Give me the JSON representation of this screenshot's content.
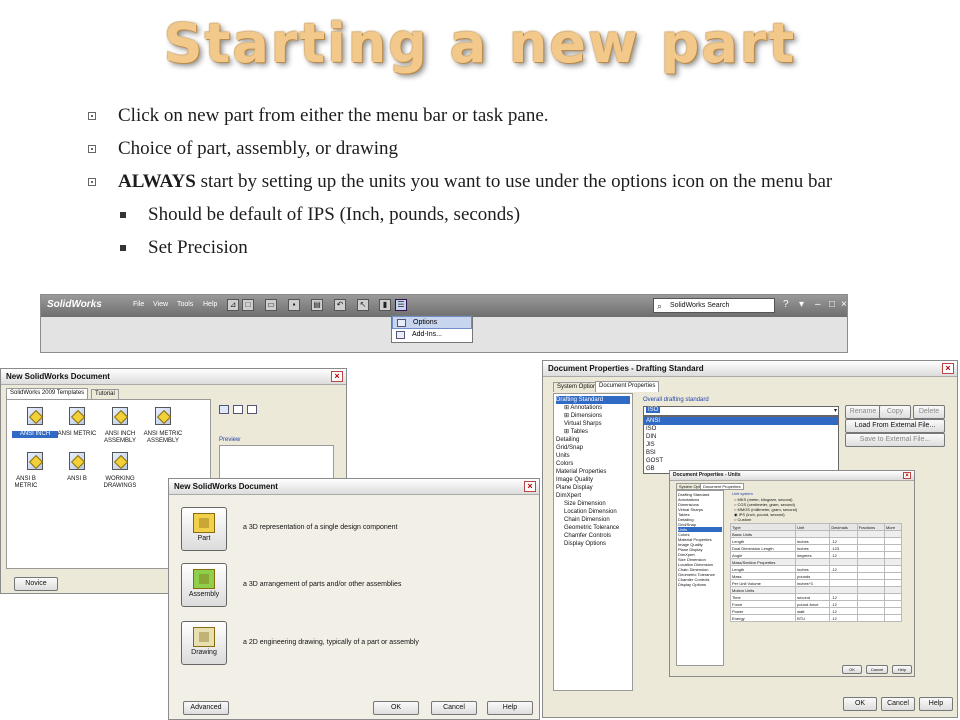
{
  "slide": {
    "title": "Starting a new part",
    "bullets": [
      {
        "text": "Click on new part from either the menu bar or task pane."
      },
      {
        "text": "Choice of part, assembly, or drawing"
      },
      {
        "bold": "ALWAYS",
        "text": " start by setting up the units you want to use under the options icon on the menu bar"
      }
    ],
    "subbullets": [
      {
        "text": "Should be default of IPS (Inch, pounds, seconds)"
      },
      {
        "text": "Set Precision"
      }
    ]
  },
  "toolbar": {
    "logo": "SolidWorks",
    "menus": [
      "File",
      "View",
      "Tools",
      "Help"
    ],
    "search_placeholder": "SolidWorks Search",
    "dropdown_items": [
      "Options",
      "Add-Ins..."
    ]
  },
  "templates_dialog": {
    "title": "New SolidWorks Document",
    "tabs": [
      "SolidWorks 2009 Templates",
      "Tutorial"
    ],
    "templates": [
      "ANSI INCH",
      "ANSI METRIC",
      "ANSI INCH ASSEMBLY",
      "ANSI METRIC ASSEMBLY",
      "ANSI B METRIC",
      "ANSI B",
      "WORKING DRAWINGS"
    ],
    "preview_label": "Preview",
    "novice_button": "Novice"
  },
  "novice_dialog": {
    "title": "New SolidWorks Document",
    "options": [
      {
        "label": "Part",
        "desc": "a 3D representation of a single design component"
      },
      {
        "label": "Assembly",
        "desc": "a 3D arrangement of parts and/or other assemblies"
      },
      {
        "label": "Drawing",
        "desc": "a 2D engineering drawing, typically of a part or assembly"
      }
    ],
    "advanced_button": "Advanced",
    "ok_button": "OK",
    "cancel_button": "Cancel",
    "help_button": "Help"
  },
  "docprops_dialog": {
    "title": "Document Properties - Drafting Standard",
    "tabs": [
      "System Options",
      "Document Properties"
    ],
    "tree": [
      {
        "label": "Drafting Standard",
        "level": 0,
        "selected": true
      },
      {
        "label": "Annotations",
        "level": 1,
        "expand": true
      },
      {
        "label": "Dimensions",
        "level": 1,
        "expand": true
      },
      {
        "label": "Virtual Sharps",
        "level": 1
      },
      {
        "label": "Tables",
        "level": 1,
        "expand": true
      },
      {
        "label": "Detailing",
        "level": 0
      },
      {
        "label": "Grid/Snap",
        "level": 0
      },
      {
        "label": "Units",
        "level": 0
      },
      {
        "label": "Colors",
        "level": 0
      },
      {
        "label": "Material Properties",
        "level": 0
      },
      {
        "label": "Image Quality",
        "level": 0
      },
      {
        "label": "Plane Display",
        "level": 0
      },
      {
        "label": "DimXpert",
        "level": 0
      },
      {
        "label": "Size Dimension",
        "level": 1
      },
      {
        "label": "Location Dimension",
        "level": 1
      },
      {
        "label": "Chain Dimension",
        "level": 1
      },
      {
        "label": "Geometric Tolerance",
        "level": 1
      },
      {
        "label": "Chamfer Controls",
        "level": 1
      },
      {
        "label": "Display Options",
        "level": 1
      }
    ],
    "standard_label": "Overall drafting standard",
    "standard_value": "ISO",
    "standards_list": [
      "ANSI",
      "ISO",
      "DIN",
      "JIS",
      "BSI",
      "GOST",
      "GB"
    ],
    "buttons": {
      "rename": "Rename",
      "copy": "Copy",
      "delete": "Delete",
      "load": "Load From External File...",
      "save": "Save to External File..."
    },
    "ok_button": "OK",
    "cancel_button": "Cancel",
    "help_button": "Help"
  },
  "units_dialog": {
    "title": "Document Properties - Units",
    "tabs": [
      "System Options",
      "Document Properties"
    ],
    "tree": [
      "Drafting Standard",
      "Annotations",
      "Dimensions",
      "Virtual Sharps",
      "Tables",
      "Detailing",
      "Grid/Snap",
      "Units",
      "Colors",
      "Material Properties",
      "Image Quality",
      "Plane Display",
      "DimXpert",
      "Size Dimension",
      "Location Dimension",
      "Chain Dimension",
      "Geometric Tolerance",
      "Chamfer Controls",
      "Display Options"
    ],
    "unit_system_label": "Unit system",
    "unit_systems": [
      "MKS (meter, kilogram, second)",
      "CGS (centimeter, gram, second)",
      "MMGS (millimeter, gram, second)",
      "IPS (inch, pound, second)",
      "Custom"
    ],
    "table_headers": [
      "Type",
      "Unit",
      "Decimals",
      "Fractions",
      "More"
    ],
    "table_rows": [
      [
        "Basic Units",
        "",
        "",
        "",
        ""
      ],
      [
        "Length",
        "inches",
        ".12",
        "",
        ""
      ],
      [
        "Dual Dimension Length",
        "inches",
        ".123",
        "",
        ""
      ],
      [
        "Angle",
        "degrees",
        ".12",
        "",
        ""
      ],
      [
        "Mass/Section Properties",
        "",
        "",
        "",
        ""
      ],
      [
        "Length",
        "inches",
        ".12",
        "",
        ""
      ],
      [
        "Mass",
        "pounds",
        "",
        "",
        ""
      ],
      [
        "Per Unit Volume",
        "inches^3",
        "",
        "",
        ""
      ],
      [
        "Motion Units",
        "",
        "",
        "",
        ""
      ],
      [
        "Time",
        "second",
        ".12",
        "",
        ""
      ],
      [
        "Force",
        "pound-force",
        ".12",
        "",
        ""
      ],
      [
        "Power",
        "watt",
        ".12",
        "",
        ""
      ],
      [
        "Energy",
        "BTU",
        ".12",
        "",
        ""
      ]
    ],
    "ok_button": "OK",
    "cancel_button": "Cancel",
    "help_button": "Help"
  }
}
